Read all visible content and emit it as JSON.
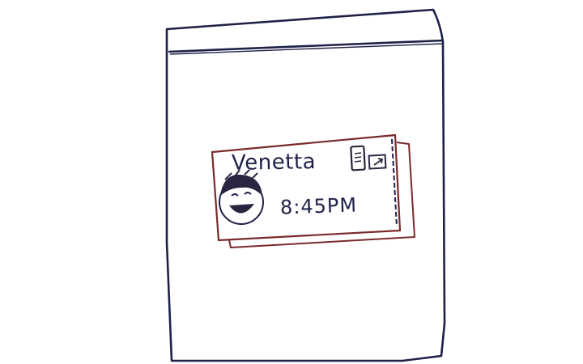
{
  "notification": {
    "caller_name": "Venetta",
    "time": "8:45PM"
  },
  "icons": {
    "avatar": "laughing-face-avatar",
    "phone": "phone-icon",
    "action": "call-forward-icon"
  },
  "colors": {
    "frame_outline": "#1f2148",
    "card_outline": "#7a2a2a",
    "text": "#1f2148"
  }
}
